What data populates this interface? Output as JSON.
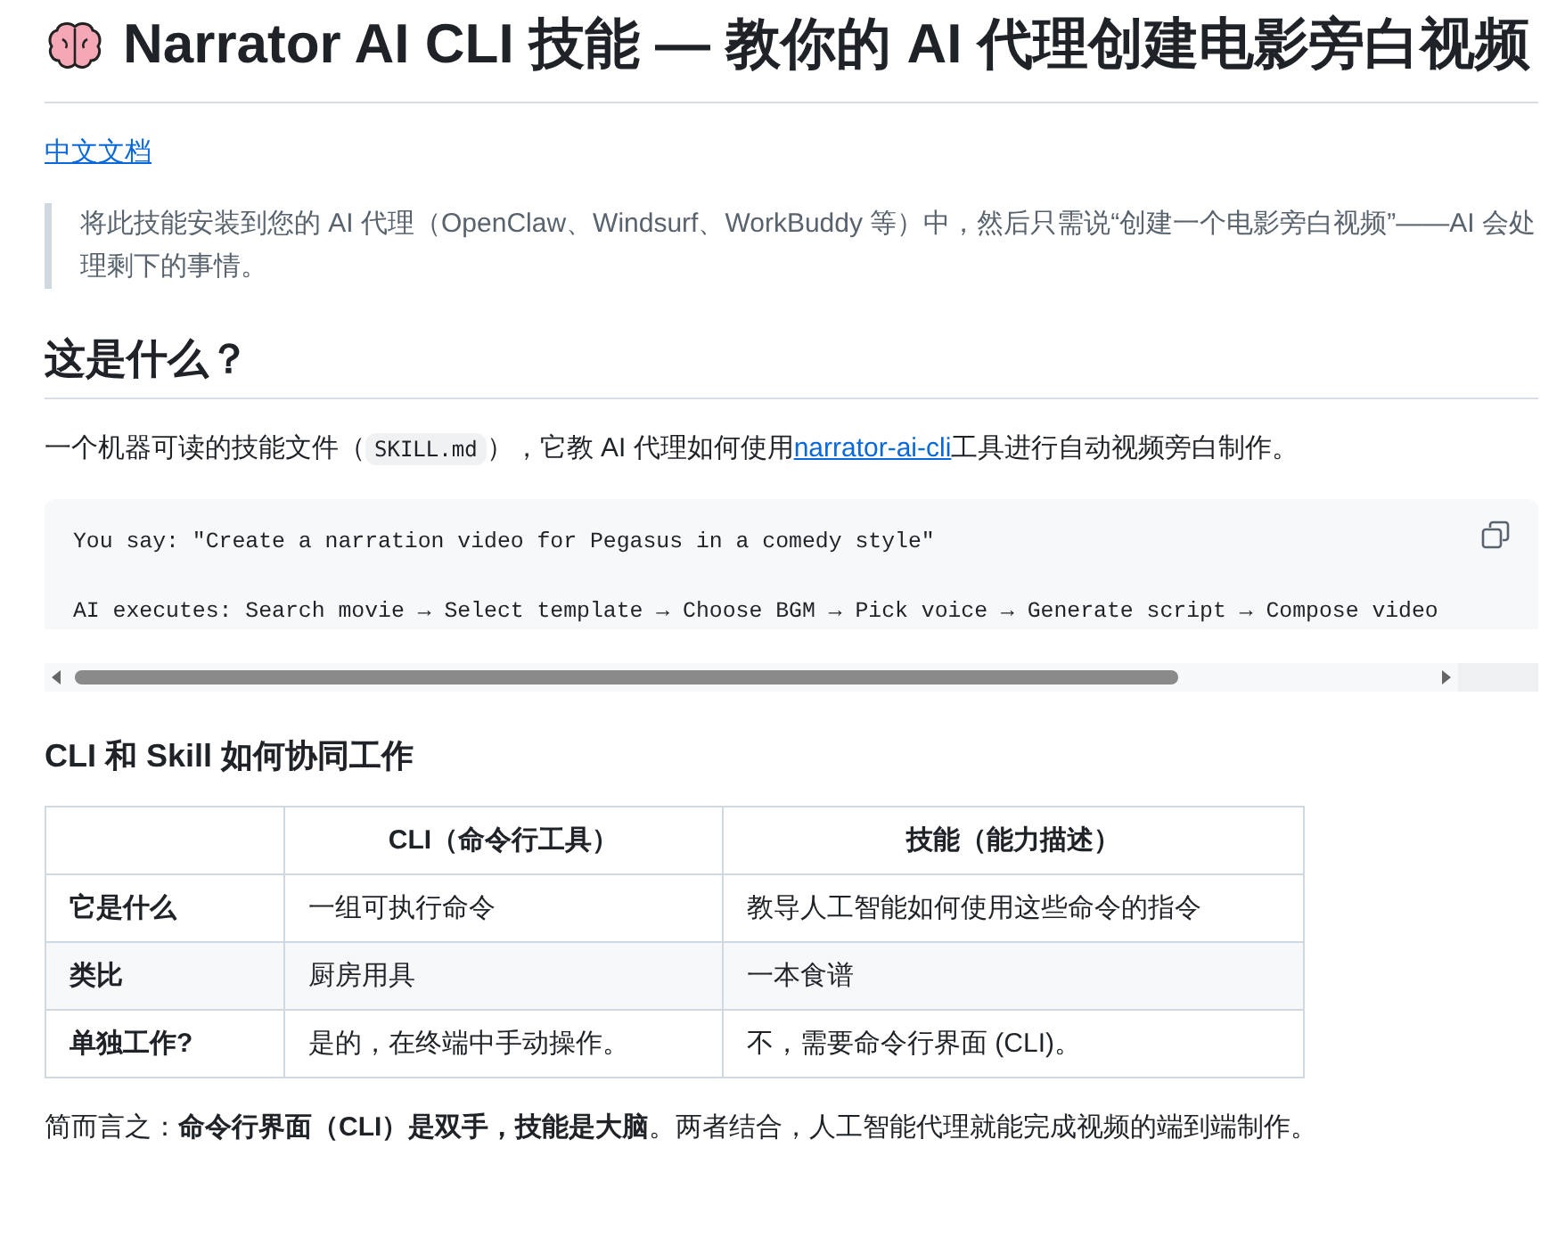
{
  "title": "Narrator AI CLI 技能 — 教你的 AI 代理创建电影旁白视频",
  "language_link": "中文文档",
  "quote": "将此技能安装到您的 AI 代理（OpenClaw、Windsurf、WorkBuddy 等）中，然后只需说“创建一个电影旁白视频”——AI 会处理剩下的事情。",
  "section_1": {
    "heading": "这是什么？",
    "text_before": "一个机器可读的技能文件（",
    "inline_code": "SKILL.md",
    "text_middle": "），它教 AI 代理如何使用",
    "link": "narrator-ai-cli",
    "text_after": "工具进行自动视频旁白制作。"
  },
  "code_block": {
    "lines": [
      "You say: \"Create a narration video for Pegasus in a comedy style\"",
      "AI executes: Search movie → Select template → Choose BGM → Pick voice → Generate script → Compose video"
    ]
  },
  "section_2": {
    "heading": "CLI 和 Skill 如何协同工作",
    "table": {
      "columns": [
        "",
        "CLI（命令行工具）",
        "技能（能力描述）"
      ],
      "rows": [
        [
          "它是什么",
          "一组可执行命令",
          "教导人工智能如何使用这些命令的指令"
        ],
        [
          "类比",
          "厨房用具",
          "一本食谱"
        ],
        [
          "单独工作?",
          "是的，在终端中手动操作。",
          "不，需要命令行界面 (CLI)。"
        ]
      ]
    },
    "summary": "简而言之：**命令行界面（CLI）是双手，技能是大脑**。两者结合，人工智能代理就能完成视频的端到端制作。"
  }
}
